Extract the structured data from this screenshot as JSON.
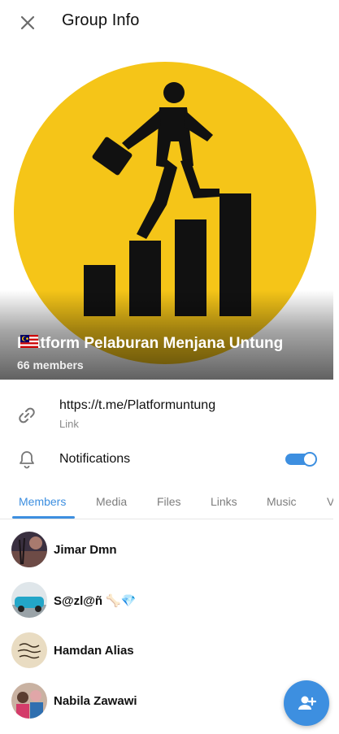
{
  "header": {
    "title": "Group Info",
    "close_icon": "close-icon"
  },
  "group": {
    "name": "Platform Pelaburan Menjana Untung",
    "members": "66 members",
    "brand_color": "#f5c518"
  },
  "link": {
    "url": "https://t.me/Platformuntung",
    "label": "Link"
  },
  "notifications": {
    "label": "Notifications",
    "enabled": true
  },
  "tabs": [
    "Members",
    "Media",
    "Files",
    "Links",
    "Music",
    "V"
  ],
  "members": [
    {
      "name": "Jimar Dmn"
    },
    {
      "name": "S@zl@ñ 🦴💎"
    },
    {
      "name": "Hamdan Alias"
    },
    {
      "name": "Nabila Zawawi"
    }
  ],
  "accent_color": "#3d8fe0"
}
